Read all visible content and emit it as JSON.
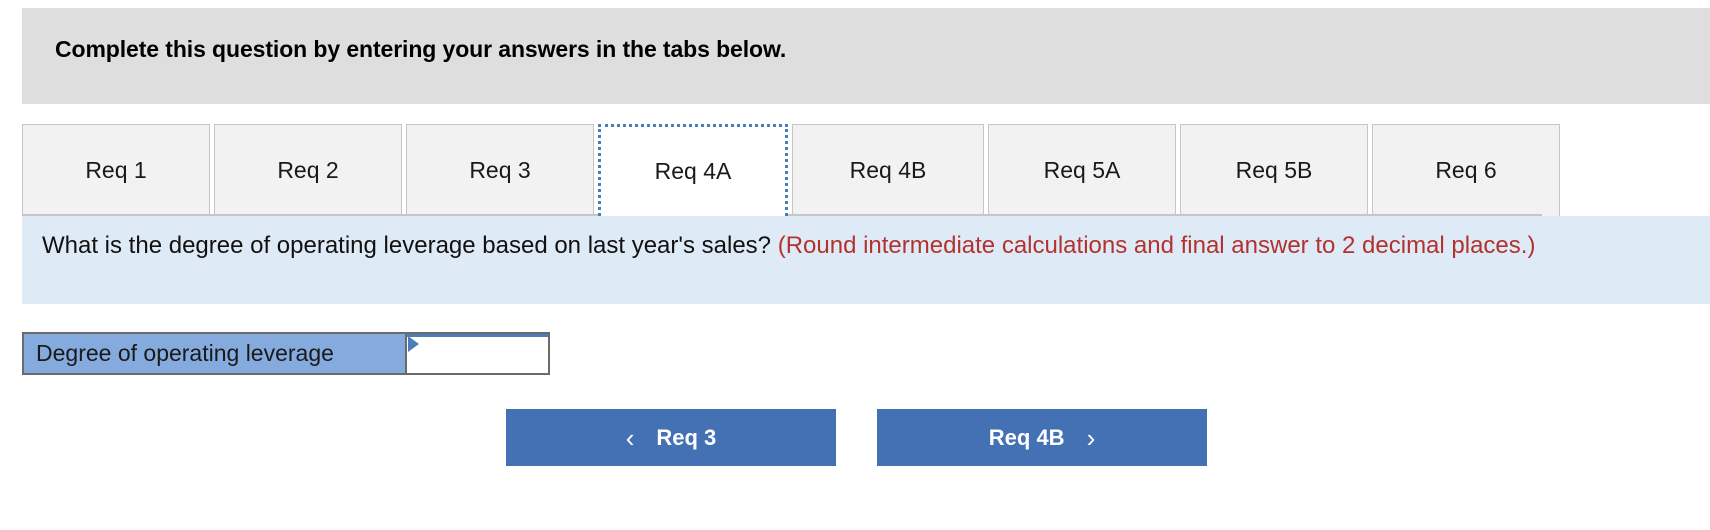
{
  "header": {
    "title": "Complete this question by entering your answers in the tabs below.",
    "background": "#dedede"
  },
  "tabs": {
    "active_index": 3,
    "items": [
      {
        "label": "Req 1"
      },
      {
        "label": "Req 2"
      },
      {
        "label": "Req 3"
      },
      {
        "label": "Req 4A"
      },
      {
        "label": "Req 4B"
      },
      {
        "label": "Req 5A"
      },
      {
        "label": "Req 5B"
      },
      {
        "label": "Req 6"
      }
    ]
  },
  "question": {
    "prompt": "What is the degree of operating leverage based on last year's sales? ",
    "note": "(Round intermediate calculations and final answer to 2 decimal places.)",
    "background": "#dfeaf7",
    "note_color": "#b2322e"
  },
  "answer": {
    "label": "Degree of operating leverage",
    "value": "",
    "placeholder": "",
    "label_background": "#85aade",
    "marker_color": "#4a7ebb"
  },
  "navigation": {
    "prev_label": "Req 3",
    "next_label": "Req 4B",
    "prev_icon": "chevron-left-icon",
    "next_icon": "chevron-right-icon",
    "prev_glyph": "‹",
    "next_glyph": "›",
    "button_color": "#4471b3"
  }
}
